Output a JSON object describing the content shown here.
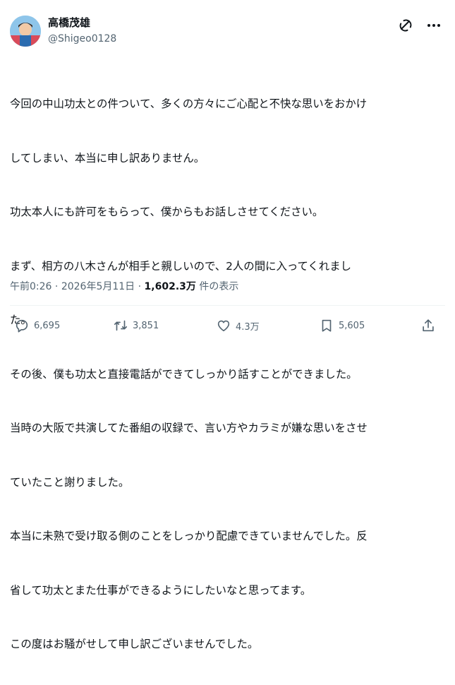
{
  "author": {
    "name": "高橋茂雄",
    "handle": "@Shigeo0128"
  },
  "post": {
    "lines": [
      "今回の中山功太との件ついて、多くの方々にご心配と不快な思いをおかけ",
      "してしまい、本当に申し訳ありません。",
      "功太本人にも許可をもらって、僕からもお話しさせてください。",
      "まず、相方の八木さんが相手と親しいので、2人の間に入ってくれまし",
      "た。",
      "その後、僕も功太と直接電話ができてしっかり話すことができました。",
      "当時の大阪で共演してた番組の収録で、言い方やカラミが嫌な思いをさせ",
      "ていたこと謝りました。",
      "本当に未熟で受け取る側のことをしっかり配慮できていませんでした。反",
      "省して功太とまた仕事ができるようにしたいなと思ってます。",
      "この度はお騒がせして申し訳ございませんでした。"
    ]
  },
  "meta": {
    "time": "午前0:26",
    "separator1": " · ",
    "date": "2026年5月11日",
    "separator2": " · ",
    "views_count": "1,602.3万",
    "views_label": " 件の表示"
  },
  "actions": {
    "replies": "6,695",
    "reposts": "3,851",
    "likes": "4.3万",
    "bookmarks": "5,605"
  },
  "icons": {
    "grok": "grok-icon",
    "more": "more-icon",
    "reply": "reply-icon",
    "repost": "repost-icon",
    "like": "like-icon",
    "bookmark": "bookmark-icon",
    "share": "share-icon"
  },
  "colors": {
    "text": "#0f1419",
    "secondary": "#536471",
    "divider": "#eff3f4"
  }
}
